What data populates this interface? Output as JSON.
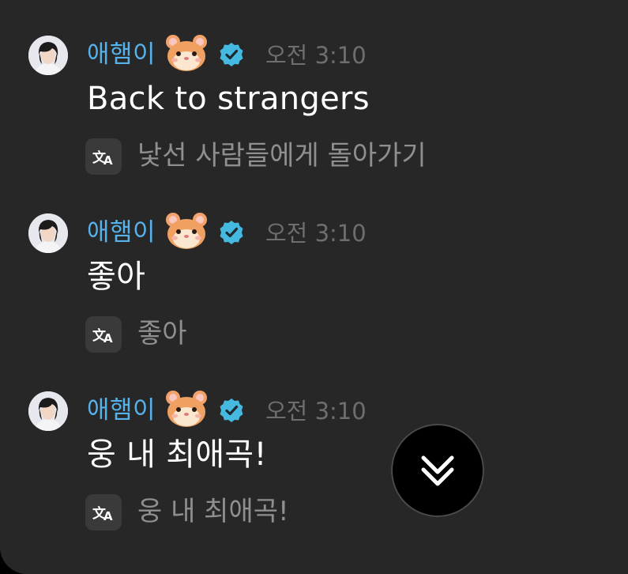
{
  "colors": {
    "background": "#272727",
    "username": "#57b1ea",
    "timestamp": "#6e6e6e",
    "message_text": "#ffffff",
    "translated_text": "#8f8f8f",
    "verified_badge": "#45b9e0"
  },
  "messages": [
    {
      "author": "애햄이",
      "author_emoji": "hamster-icon",
      "verified": true,
      "timestamp": "오전 3:10",
      "text": "Back to strangers",
      "translation": "낯선 사람들에게 돌아가기"
    },
    {
      "author": "애햄이",
      "author_emoji": "hamster-icon",
      "verified": true,
      "timestamp": "오전 3:10",
      "text": "좋아",
      "translation": "좋아"
    },
    {
      "author": "애햄이",
      "author_emoji": "hamster-icon",
      "verified": true,
      "timestamp": "오전 3:10",
      "text": "웅 내 최애곡!",
      "translation": "웅 내 최애곡!"
    }
  ],
  "scroll_button": {
    "icon": "double-chevron-down-icon"
  }
}
